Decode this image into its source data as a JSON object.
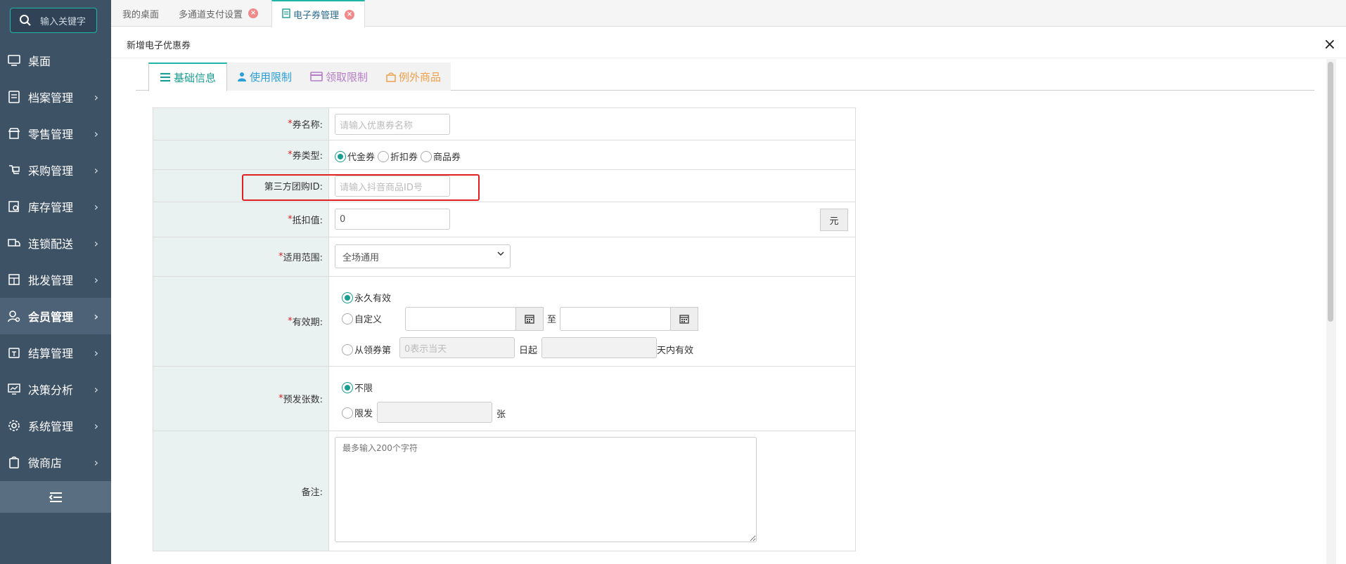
{
  "sidebar": {
    "search_placeholder": "输入关键字",
    "items": [
      {
        "label": "桌面",
        "icon": "monitor-icon",
        "chevron": false
      },
      {
        "label": "档案管理",
        "icon": "archive-icon",
        "chevron": true
      },
      {
        "label": "零售管理",
        "icon": "store-icon",
        "chevron": true
      },
      {
        "label": "采购管理",
        "icon": "purchase-icon",
        "chevron": true
      },
      {
        "label": "库存管理",
        "icon": "inventory-icon",
        "chevron": true
      },
      {
        "label": "连锁配送",
        "icon": "truck-icon",
        "chevron": true
      },
      {
        "label": "批发管理",
        "icon": "wholesale-icon",
        "chevron": true
      },
      {
        "label": "会员管理",
        "icon": "member-icon",
        "chevron": true,
        "active": true
      },
      {
        "label": "结算管理",
        "icon": "settlement-icon",
        "chevron": true
      },
      {
        "label": "决策分析",
        "icon": "chart-icon",
        "chevron": true
      },
      {
        "label": "系统管理",
        "icon": "gear-icon",
        "chevron": true
      },
      {
        "label": "微商店",
        "icon": "shop-bag-icon",
        "chevron": true
      }
    ]
  },
  "tabs": [
    {
      "label": "我的桌面",
      "closable": false
    },
    {
      "label": "多通道支付设置",
      "closable": true
    },
    {
      "label": "电子券管理",
      "closable": true,
      "active": true
    }
  ],
  "dialog": {
    "title": "新增电子优惠券",
    "close": "×"
  },
  "subtabs": [
    {
      "label": "基础信息",
      "icon": "list-icon",
      "color": "#1a9e93"
    },
    {
      "label": "使用限制",
      "icon": "user-icon",
      "color": "#2b9fd6"
    },
    {
      "label": "领取限制",
      "icon": "card-icon",
      "color": "#b57cc7"
    },
    {
      "label": "例外商品",
      "icon": "bag-icon",
      "color": "#f0a04b"
    }
  ],
  "form": {
    "name": {
      "label": "券名称:",
      "placeholder": "请输入优惠券名称"
    },
    "type": {
      "label": "券类型:",
      "options": [
        "代金券",
        "折扣券",
        "商品券"
      ],
      "selected": "代金券"
    },
    "third_party": {
      "label": "第三方团购ID:",
      "placeholder": "请输入抖音商品ID号"
    },
    "deduction": {
      "label": "抵扣值:",
      "value": "0",
      "unit": "元"
    },
    "scope": {
      "label": "适用范围:",
      "value": "全场通用"
    },
    "validity": {
      "label": "有效期:",
      "opt_forever": "永久有效",
      "opt_custom": "自定义",
      "to": "至",
      "opt_from": "从领券第",
      "from_placeholder": "0表示当天",
      "day_start": "日起",
      "days_valid": "天内有效",
      "selected": "永久有效"
    },
    "issue": {
      "label": "预发张数:",
      "opt_unlimited": "不限",
      "opt_limit": "限发",
      "unit": "张",
      "selected": "不限"
    },
    "remark": {
      "label": "备注:",
      "placeholder": "最多输入200个字符"
    }
  },
  "colors": {
    "accent": "#1fb5a7",
    "sidebar": "#3e5266",
    "required": "#e02020",
    "highlight": "#e02020"
  }
}
